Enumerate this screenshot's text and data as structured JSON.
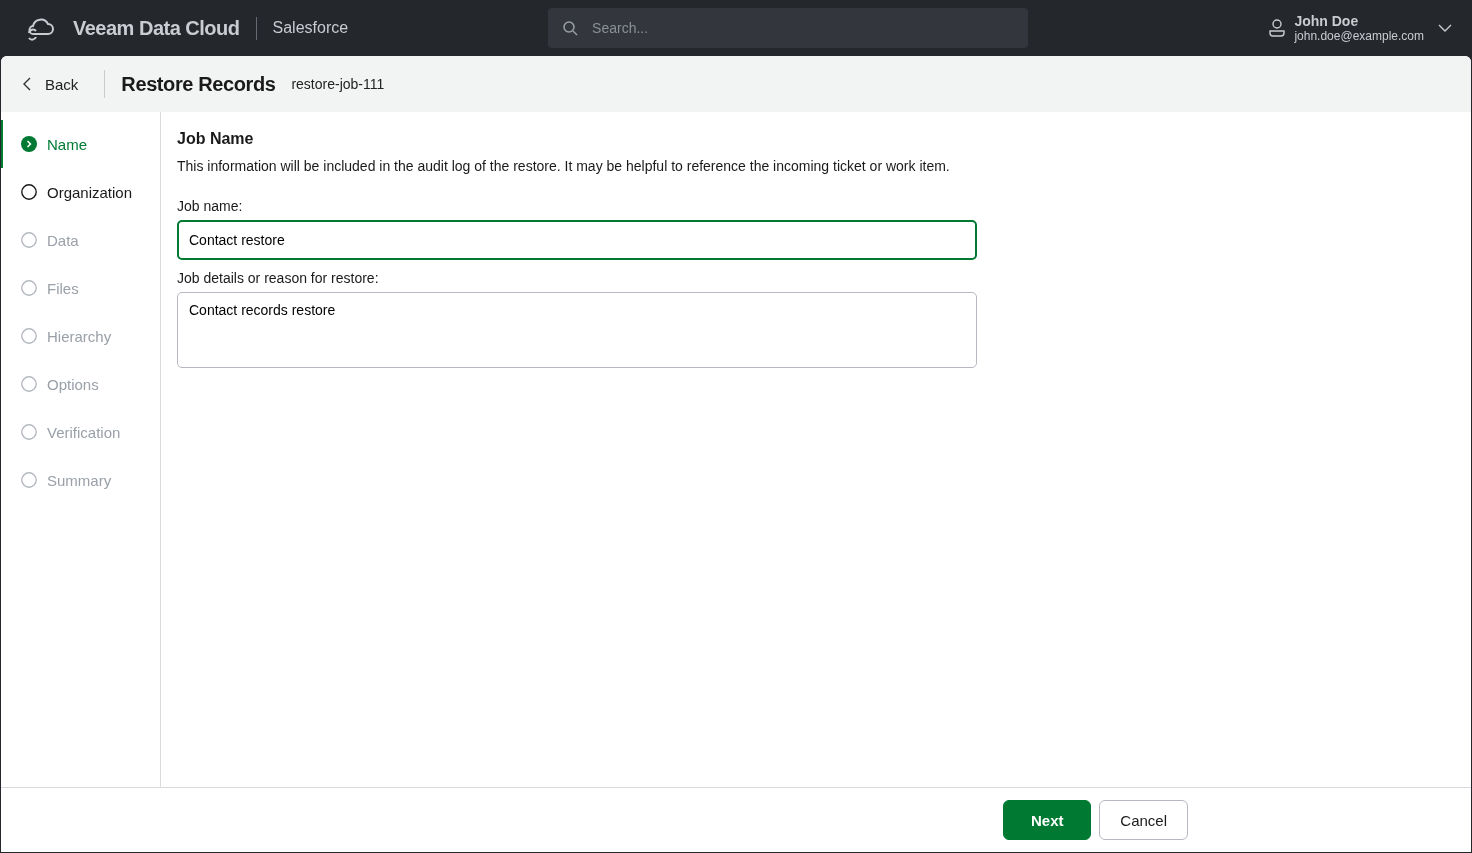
{
  "topbar": {
    "brand": "Veeam Data Cloud",
    "product": "Salesforce",
    "search": {
      "placeholder": "Search..."
    },
    "user": {
      "name": "John Doe",
      "email": "john.doe@example.com"
    }
  },
  "header": {
    "back": "Back",
    "title": "Restore Records",
    "job_id": "restore-job-111"
  },
  "steps": [
    {
      "label": "Name",
      "selected": true,
      "disabled": false
    },
    {
      "label": "Organization",
      "selected": false,
      "disabled": false
    },
    {
      "label": "Data",
      "selected": false,
      "disabled": true
    },
    {
      "label": "Files",
      "selected": false,
      "disabled": true
    },
    {
      "label": "Hierarchy",
      "selected": false,
      "disabled": true
    },
    {
      "label": "Options",
      "selected": false,
      "disabled": true
    },
    {
      "label": "Verification",
      "selected": false,
      "disabled": true
    },
    {
      "label": "Summary",
      "selected": false,
      "disabled": true
    }
  ],
  "form": {
    "heading": "Job Name",
    "description": "This information will be included in the audit log of the restore. It may be helpful to reference the incoming ticket or work item.",
    "job_name_label": "Job name:",
    "job_name_value": "Contact restore",
    "details_label": "Job details or reason for restore:",
    "details_value": "Contact records restore"
  },
  "footer": {
    "buttons": [
      "Next",
      "Cancel"
    ]
  }
}
